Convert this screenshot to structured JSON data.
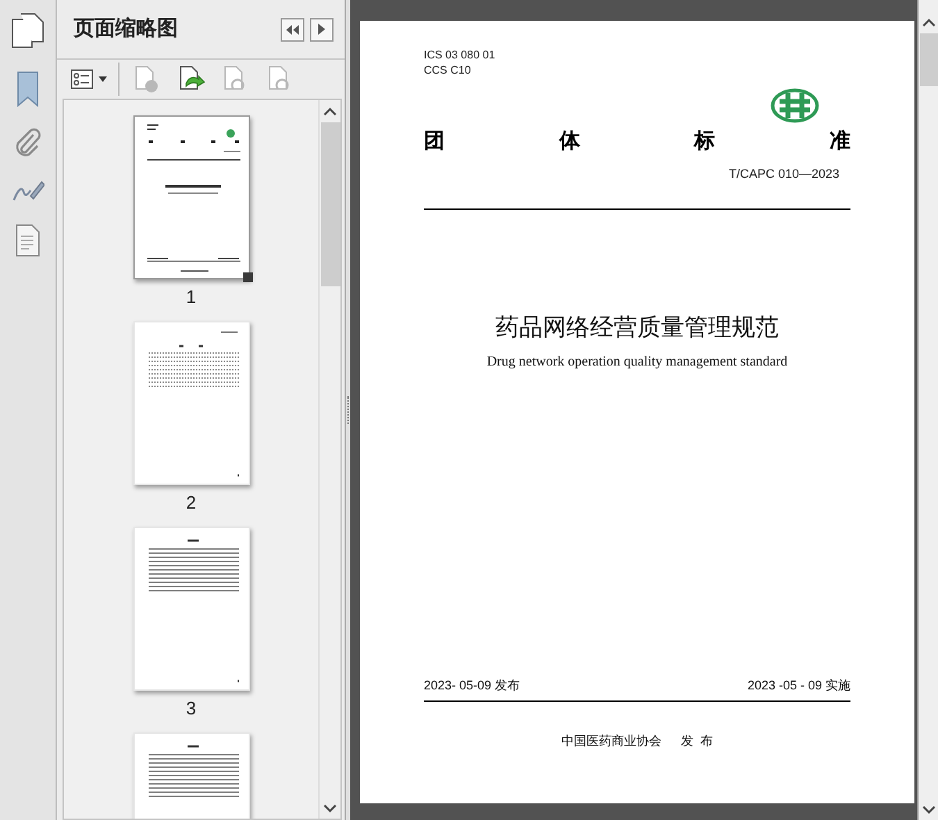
{
  "panel": {
    "title": "页面缩略图"
  },
  "toolbar": [
    {
      "kind": "options",
      "disabled": false
    },
    {
      "kind": "delete",
      "disabled": true
    },
    {
      "kind": "insert",
      "disabled": false
    },
    {
      "kind": "undo",
      "disabled": true
    },
    {
      "kind": "redo",
      "disabled": true
    }
  ],
  "thumbnails": [
    {
      "label": "1",
      "selected": true,
      "kind": "cover"
    },
    {
      "label": "2",
      "selected": false,
      "kind": "contents"
    },
    {
      "label": "3",
      "selected": false,
      "kind": "text"
    },
    {
      "selected": false,
      "kind": "text"
    }
  ],
  "page": {
    "ics": "ICS  03 080 01",
    "ccs": "CCS  C10",
    "heading": [
      "团",
      "体",
      "标",
      "准"
    ],
    "code": "T/CAPC 010—2023",
    "title": "药品网络经营质量管理规范",
    "subtitle": "Drug network operation quality management standard",
    "issued": "2023- 05-09 发布",
    "effective": "2023 -05 - 09 实施",
    "publisher": "中国医药商业协会",
    "publish": "发  布"
  }
}
